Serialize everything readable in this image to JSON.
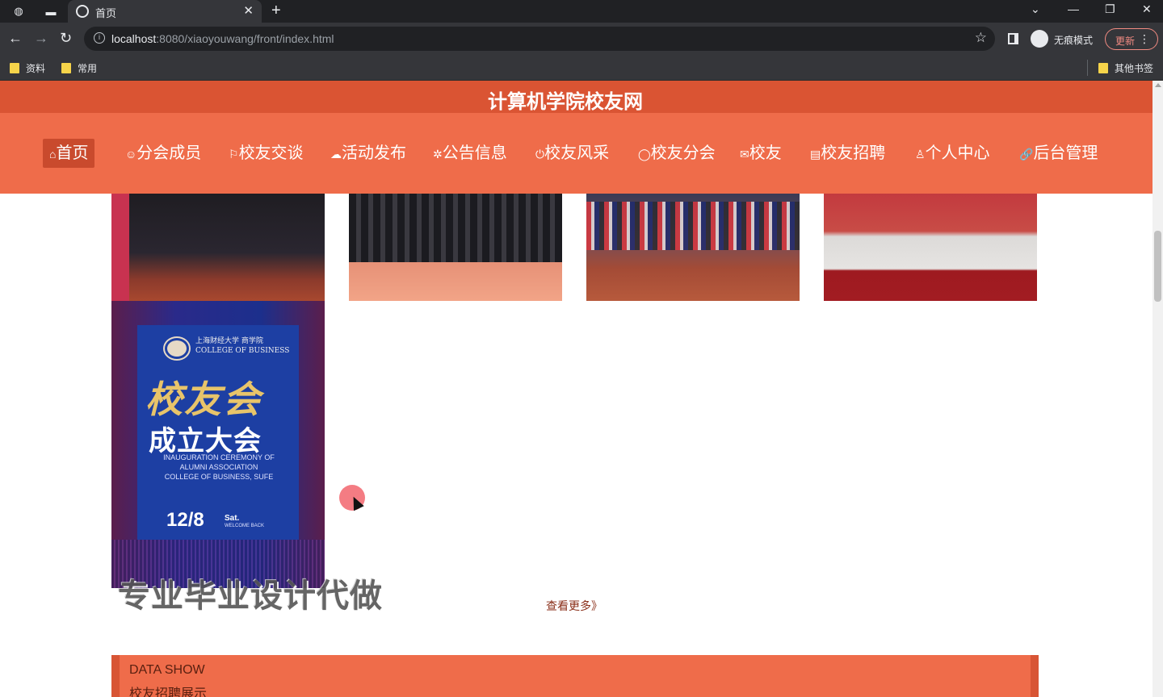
{
  "browser": {
    "tab_title": "首页",
    "url_host": "localhost",
    "url_rest": ":8080/xiaoyouwang/front/index.html",
    "incognito_label": "无痕模式",
    "update_label": "更新",
    "bookmarks": [
      "资料",
      "常用"
    ],
    "other_bookmarks": "其他书签"
  },
  "site": {
    "title": "计算机学院校友网",
    "nav": [
      {
        "icon": "⌂",
        "label": "首页"
      },
      {
        "icon": "☺",
        "label": "分会成员"
      },
      {
        "icon": "⚐",
        "label": "校友交谈"
      },
      {
        "icon": "☁",
        "label": "活动发布"
      },
      {
        "icon": "✲",
        "label": "公告信息"
      },
      {
        "icon": "⏻",
        "label": "校友风采"
      },
      {
        "icon": "◯",
        "label": "校友分会"
      },
      {
        "icon": "✉",
        "label": "校友"
      },
      {
        "icon": "▤",
        "label": "校友招聘"
      },
      {
        "icon": "♙",
        "label": "个人中心"
      },
      {
        "icon": "🔗",
        "label": "后台管理"
      }
    ]
  },
  "poster": {
    "school_cn": "上海财经大学 商学院",
    "school_en": "COLLEGE OF BUSINESS",
    "headline": "校友会",
    "subheadline": "成立大会",
    "en_line1": "INAUGURATION CEREMONY OF",
    "en_line2": "ALUMNI ASSOCIATION",
    "en_line3": "COLLEGE OF BUSINESS, SUFE",
    "date": "12/8",
    "day": "Sat.",
    "welcome": "WELCOME BACK"
  },
  "content": {
    "watermark": "专业毕业设计代做",
    "more_link": "查看更多》",
    "data_show_en": "DATA SHOW",
    "data_show_cn": "校友招聘展示"
  },
  "colors": {
    "header_dark": "#da5433",
    "header_nav": "#ef6c4a",
    "active_nav": "#c94a2d"
  }
}
